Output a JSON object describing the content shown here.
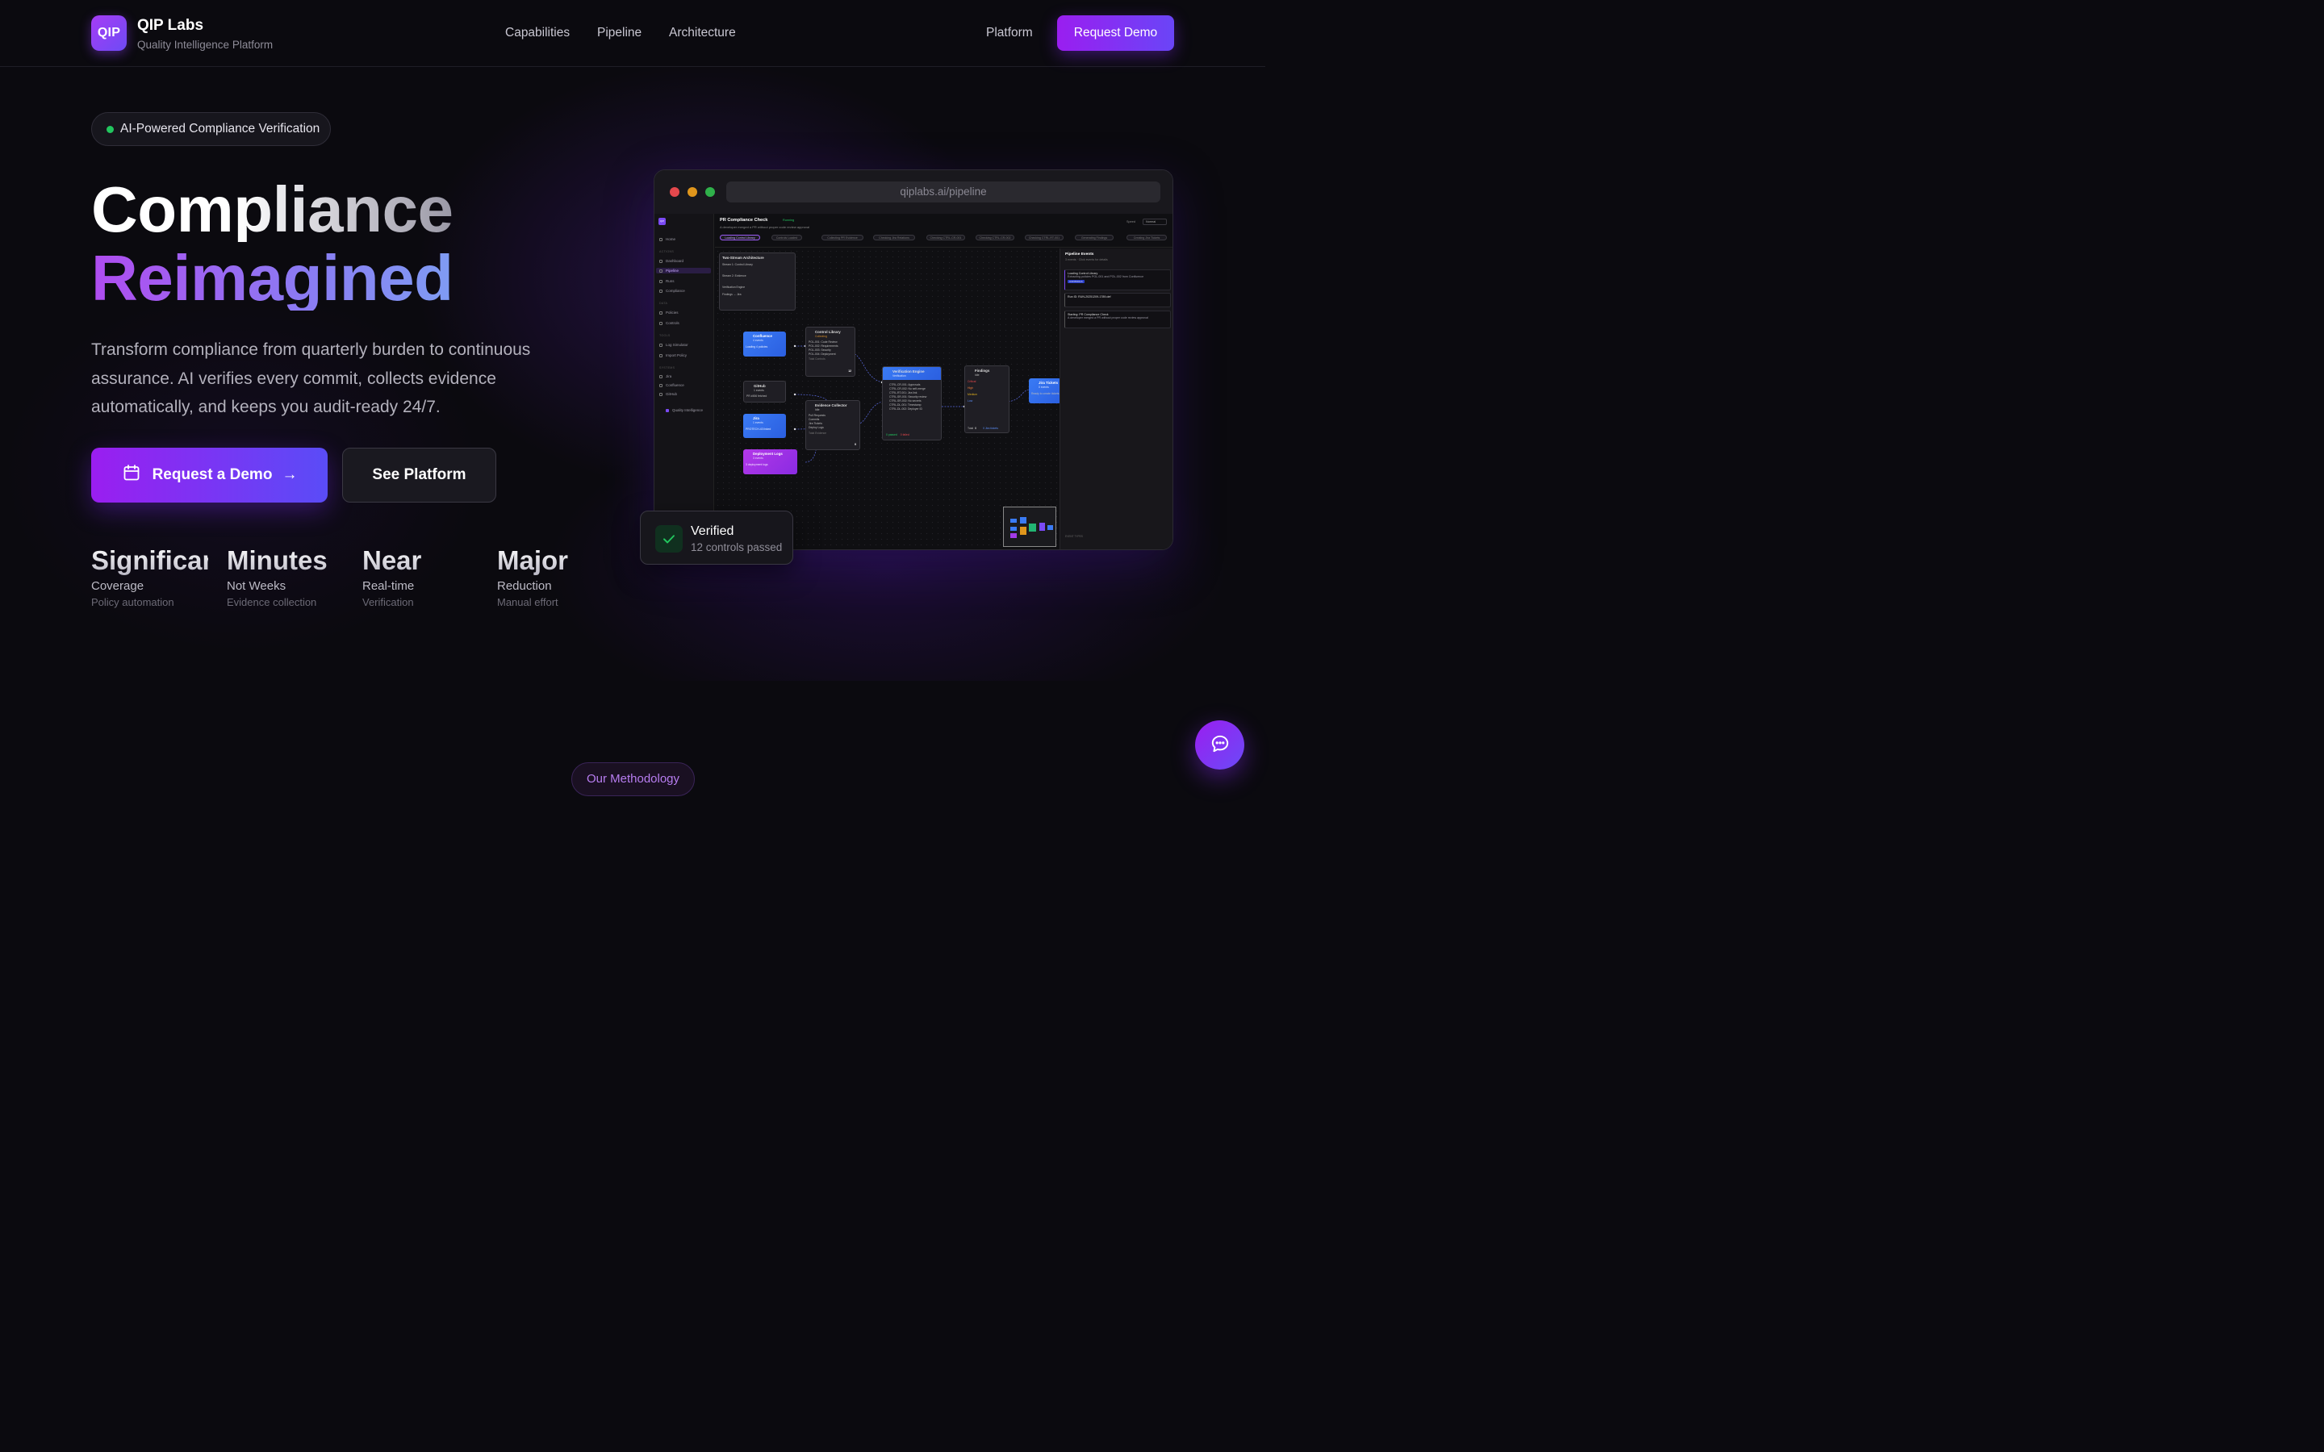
{
  "brand": {
    "logo": "QIP",
    "name": "QIP Labs",
    "tagline": "Quality Intelligence Platform"
  },
  "nav": {
    "items": [
      "Capabilities",
      "Pipeline",
      "Architecture"
    ],
    "platform": "Platform",
    "cta": "Request Demo"
  },
  "hero": {
    "pill": "AI-Powered Compliance Verification",
    "title_line1": "Compliance",
    "title_line2": "Reimagined",
    "lede": "Transform compliance from quarterly burden to continuous assurance. AI verifies every commit, collects evidence automatically, and keeps you audit-ready 24/7.",
    "cta_primary": "Request a Demo",
    "cta_secondary": "See Platform",
    "stats": [
      {
        "value": "Significant",
        "label": "Coverage",
        "sub": "Policy automation"
      },
      {
        "value": "Minutes",
        "label": "Not Weeks",
        "sub": "Evidence collection"
      },
      {
        "value": "Near",
        "label": "Real-time",
        "sub": "Verification"
      },
      {
        "value": "Major",
        "label": "Reduction",
        "sub": "Manual effort"
      }
    ]
  },
  "browser": {
    "url": "qiplabs.ai/pipeline",
    "app": {
      "logo": "QIP",
      "sidebar": {
        "top": [
          "Home"
        ],
        "sec_actions": "ACTIONS",
        "actions": [
          "Dashboard",
          "Pipeline",
          "Runs",
          "Compliance"
        ],
        "sec_data": "DATA",
        "data": [
          "Policies",
          "Controls"
        ],
        "sec_tools": "TOOLS",
        "tools": [
          "Log Simulator",
          "Import Policy"
        ],
        "sec_systems": "SYSTEMS",
        "systems": [
          "Jira",
          "Confluence",
          "GitHub"
        ],
        "footer": "Quality Intelligence"
      },
      "title": "PR Compliance Check",
      "status": "Running",
      "subtitle": "A developer merged a PR without proper code review approval",
      "speed_label": "Speed",
      "speed_value": "Normal",
      "steps": [
        "Loading Control Library",
        "Controls Loaded",
        "Collecting PR Evidence",
        "Checking Jira Relations",
        "Checking CTRL-CR-001",
        "Checking CTRL-CR-002",
        "Checking CTRL-RT-001",
        "Generating Findings",
        "Creating Jira Tickets"
      ],
      "arch": {
        "title": "Two-Stream Architecture",
        "rows": [
          "Stream 1: Control Library",
          "Stream 2: Evidence",
          "Verification Engine",
          "Findings → Jira"
        ]
      },
      "nodes": {
        "confluence": {
          "title": "Confluence",
          "sub": "4 events",
          "note": "Loading 4 policies"
        },
        "control_library": {
          "title": "Control Library",
          "sub": "Collecting",
          "rows": [
            "POL-001: Code Review",
            "POL-002: Requirements",
            "POL-003: Security",
            "POL-004: Deployment"
          ],
          "total_label": "Total Controls",
          "total": "12"
        },
        "github": {
          "title": "GitHub",
          "sub": "1 events",
          "note": "PR #456 fetched"
        },
        "jira": {
          "title": "Jira",
          "sub": "1 events",
          "note": "PROTECH-43 linked"
        },
        "deploy": {
          "title": "Deployment Logs",
          "sub": "3 events",
          "note": "3 deployment logs"
        },
        "evidence": {
          "title": "Evidence Collector",
          "sub": "Idle",
          "rows": [
            "Pull Requests",
            "Commits",
            "Jira Tickets",
            "Deploy Logs"
          ],
          "total_label": "Total Evidence",
          "total": "0"
        },
        "engine": {
          "title": "Verification Engine",
          "sub": "Verification",
          "rows": [
            "CTRL-CR-001: Approvals",
            "CTRL-CR-002: No self-merge",
            "CTRL-RT-001: Jira link",
            "CTRL-SR-001: Security review",
            "CTRL-SR-002: No secrets",
            "CTRL-DL-001: Timestamp",
            "CTRL-DL-002: Deployer ID"
          ],
          "passed": "0 passed",
          "failed": "0 failed"
        },
        "findings": {
          "title": "Findings",
          "sub": "Idle",
          "rows": [
            "Critical",
            "High",
            "Medium",
            "Low"
          ],
          "total_label": "Total",
          "total": "0",
          "note": "0 Jira tickets"
        },
        "jira_tickets": {
          "title": "Jira Tickets",
          "sub": "0 events",
          "note": "Ready to create tickets"
        }
      },
      "events": {
        "title": "Pipeline Events",
        "sub": "3 events · Click events for details",
        "items": [
          {
            "title": "Loading Control Library",
            "detail": "Extracting policies POL-001 and POL-002 from Confluence",
            "tag": "CONTROLS"
          },
          {
            "title": "Run ID: RUN-20251209-1789-def",
            "detail": ""
          },
          {
            "title": "Starting: PR Compliance Check",
            "detail": "A developer merged a PR without proper code review approval"
          }
        ],
        "footer": "EVENT TYPES"
      }
    }
  },
  "verified": {
    "title": "Verified",
    "sub": "12 controls passed"
  },
  "methodology": "Our Methodology",
  "colors": {
    "accent_purple": "#9a1ef0",
    "accent_indigo": "#6a45f7",
    "success": "#22c55e",
    "bg": "#0b0a0f"
  },
  "icons": {
    "calendar": "calendar-icon",
    "arrow": "arrow-right-icon",
    "check": "check-icon",
    "chat": "chat-bubble-icon"
  }
}
